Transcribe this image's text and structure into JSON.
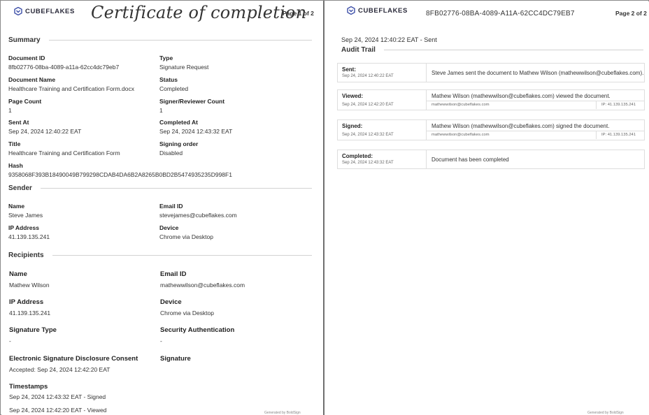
{
  "brand": {
    "name": "CUBEFLAKES",
    "accent": "#3d4fa8"
  },
  "page1": {
    "title": "Certificate of completion",
    "page_label": "Page 1 of 2",
    "summary": {
      "heading": "Summary",
      "document_id": {
        "label": "Document ID",
        "value": "8fb02776-08ba-4089-a11a-62cc4dc79eb7"
      },
      "type": {
        "label": "Type",
        "value": "Signature Request"
      },
      "document_name": {
        "label": "Document Name",
        "value": "Healthcare Training and Certification Form.docx"
      },
      "status": {
        "label": "Status",
        "value": "Completed"
      },
      "page_count": {
        "label": "Page Count",
        "value": "1"
      },
      "signer_count": {
        "label": "Signer/Reviewer Count",
        "value": "1"
      },
      "sent_at": {
        "label": "Sent At",
        "value": "Sep 24, 2024 12:40:22 EAT"
      },
      "completed_at": {
        "label": "Completed At",
        "value": "Sep 24, 2024 12:43:32 EAT"
      },
      "title_field": {
        "label": "Title",
        "value": "Healthcare Training and Certification Form"
      },
      "signing_order": {
        "label": "Signing order",
        "value": "Disabled"
      },
      "hash": {
        "label": "Hash",
        "value": "9358068F393B18490049B799298CDAB4DA6B2A8265B0BD2B5474935235D998F1"
      }
    },
    "sender": {
      "heading": "Sender",
      "name": {
        "label": "Name",
        "value": "Steve  James"
      },
      "email": {
        "label": "Email ID",
        "value": "stevejames@cubeflakes.com"
      },
      "ip": {
        "label": "IP Address",
        "value": "41.139.135.241"
      },
      "device": {
        "label": "Device",
        "value": "Chrome via Desktop"
      }
    },
    "recipients": {
      "heading": "Recipients",
      "name": {
        "label": "Name",
        "value": "Mathew Wilson"
      },
      "email": {
        "label": "Email ID",
        "value": "mathewwilson@cubeflakes.com"
      },
      "ip": {
        "label": "IP Address",
        "value": "41.139.135.241"
      },
      "device": {
        "label": "Device",
        "value": "Chrome via Desktop"
      },
      "signature_type": {
        "label": "Signature Type",
        "value": "-"
      },
      "security_auth": {
        "label": "Security Authentication",
        "value": "-"
      },
      "consent": {
        "label": "Electronic Signature Disclosure Consent",
        "value": "Accepted: Sep 24, 2024 12:42:20 EAT"
      },
      "signature": {
        "label": "Signature"
      },
      "timestamps_label": "Timestamps",
      "timestamps": [
        "Sep 24, 2024 12:43:32 EAT - Signed",
        "Sep 24, 2024 12:42:20 EAT - Viewed"
      ]
    },
    "generated_by": "Generated by BoldSign"
  },
  "page2": {
    "document_id": "8FB02776-08BA-4089-A11A-62CC4DC79EB7",
    "page_label": "Page 2 of 2",
    "sent_line": "Sep 24, 2024 12:40:22 EAT - Sent",
    "audit_heading": "Audit Trail",
    "audit": [
      {
        "action": "Sent:",
        "time": "Sep 24, 2024 12:40:22 EAT",
        "desc": "Steve  James sent the document to Mathew Wilson (mathewwilson@cubeflakes.com).",
        "email": "",
        "ip": ""
      },
      {
        "action": "Viewed:",
        "time": "Sep 24, 2024 12:42:20 EAT",
        "desc": "Mathew Wilson (mathewwilson@cubeflakes.com) viewed the document.",
        "email": "mathewwilson@cubeflakes.com",
        "ip": "IP: 41.139.135.241"
      },
      {
        "action": "Signed:",
        "time": "Sep 24, 2024 12:43:32 EAT",
        "desc": "Mathew Wilson (mathewwilson@cubeflakes.com) signed the document.",
        "email": "mathewwilson@cubeflakes.com",
        "ip": "IP: 41.139.135.241"
      },
      {
        "action": "Completed:",
        "time": "Sep 24, 2024 12:43:32 EAT",
        "desc": "Document has been completed",
        "email": "",
        "ip": ""
      }
    ],
    "generated_by": "Generated by BoldSign"
  }
}
